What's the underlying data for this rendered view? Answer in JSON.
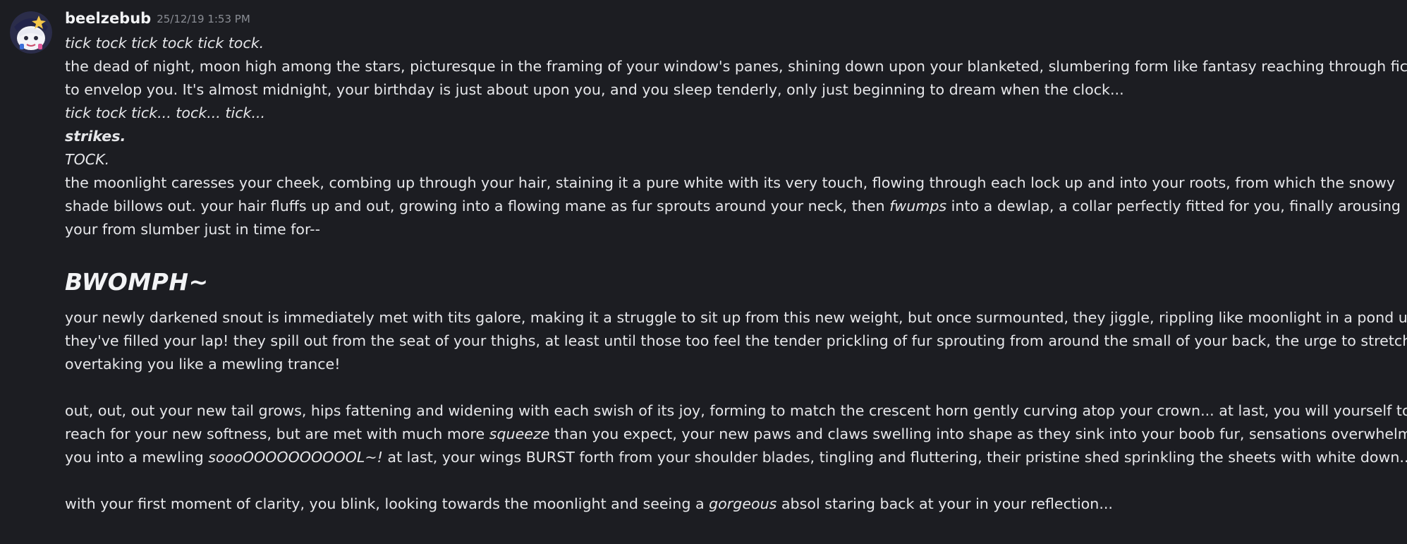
{
  "message": {
    "author": "beelzebub",
    "timestamp": "25/12/19 1:53 PM",
    "colors": {
      "background": "#1c1d22",
      "text": "#e6e7ea",
      "timestamp": "#8a8d94"
    },
    "avatar_icon": "avatar-icon",
    "lines": {
      "l1": "tick tock tick tock tick tock.",
      "l2a": "the dead of night, moon high among the stars, picturesque in the framing of your window's panes, shining down upon your blanketed, slumbering form like fantasy reaching through fiction",
      "l2b": "to envelop you. It's almost midnight, your birthday is just about upon you, and you sleep tenderly, only just beginning to dream when the clock...",
      "l3": "tick tock tick... tock... tick...",
      "l4": "strikes.",
      "l5": "TOCK.",
      "p6a": "the moonlight caresses your cheek, combing up through your hair, staining it a pure white with its very touch, flowing through each lock up and into your roots, from which the snowy",
      "p6b": "shade billows out. your hair fluffs up and out, growing into a flowing mane as fur sprouts around your neck, then ",
      "p6b_em": "fwumps",
      "p6b_end": " into a dewlap, a collar perfectly fitted for you, finally arousing",
      "p6c": "your from slumber just in time for--",
      "heading": "BWOMPH~",
      "p7a": "your newly darkened snout is immediately met with tits galore, making it a struggle to sit up from this new weight, but once surmounted, they jiggle, rippling like moonlight in a pond until",
      "p7b": "they've filled your lap! they spill out from the seat of your thighs, at least until those too feel the tender prickling of fur sprouting from around the small of your back, the urge to stretch",
      "p7c": "overtaking you like a mewling trance!",
      "p8a": "out, out, out your new tail grows, hips fattening and widening with each swish of its joy, forming to match the crescent horn gently curving atop your crown... at last, you will yourself to",
      "p8b": "reach for your new softness, but are met with much more ",
      "p8b_em": "squeeze",
      "p8b_end": " than you expect, your new paws and claws swelling into shape as they sink into your boob fur, sensations overwhelming",
      "p8c": "you into a mewling ",
      "p8c_em": "soooOOOOOOOOOOL~!",
      "p8c_end": " at last, your wings BURST forth from your shoulder blades, tingling and fluttering, their pristine shed sprinkling the sheets with white down...",
      "p9a": "with your first moment of clarity, you blink, looking towards the moonlight and seeing a ",
      "p9a_em": "gorgeous",
      "p9a_end": " absol staring back at your in your reflection..."
    }
  }
}
